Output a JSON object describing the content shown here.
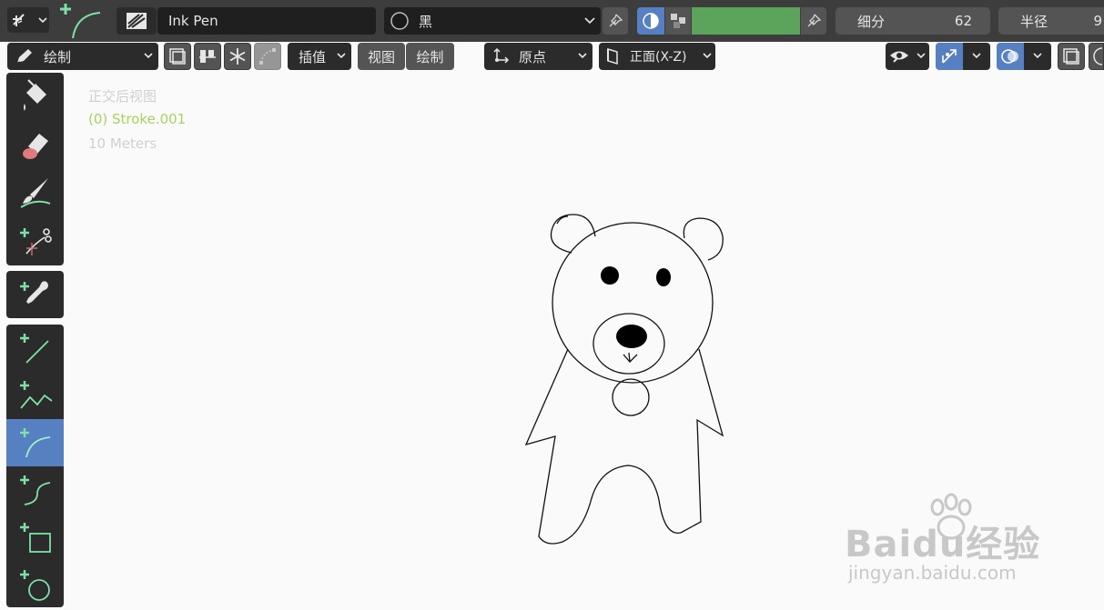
{
  "topbar": {
    "brush_name": "Ink Pen",
    "material_name": "黑",
    "subdivision_label": "细分",
    "subdivision_value": "62",
    "radius_label": "半径",
    "radius_value": "9",
    "color_swatch": "#5ca35c"
  },
  "toolbar_header": {
    "mode_label": "绘制",
    "interpolate_label": "插值",
    "view_label": "视图",
    "draw_label": "绘制",
    "origin_label": "原点",
    "plane_label": "正面(X-Z)"
  },
  "viewport": {
    "view_name": "正交后视图",
    "object_name": "(0) Stroke.001",
    "scale_text": "10 Meters",
    "object_name_color": "#a6d25d"
  },
  "tools": [
    {
      "icon": "fill-bucket-icon"
    },
    {
      "icon": "eraser-icon"
    },
    {
      "icon": "tint-brush-icon"
    },
    {
      "icon": "cutter-icon"
    },
    {
      "icon": "eyedropper-icon"
    },
    {
      "icon": "line-icon"
    },
    {
      "icon": "polyline-icon"
    },
    {
      "icon": "arc-icon",
      "active": true
    },
    {
      "icon": "curve-icon"
    },
    {
      "icon": "box-icon"
    },
    {
      "icon": "circle-icon"
    }
  ],
  "watermark": {
    "brand": "Baidu经验",
    "url": "jingyan.baidu.com"
  },
  "colors": {
    "header_bg": "#3d3d3d",
    "active_blue": "#5680c2",
    "viewport_bg": "#fafafa",
    "accent_green": "#7ee0a6"
  }
}
